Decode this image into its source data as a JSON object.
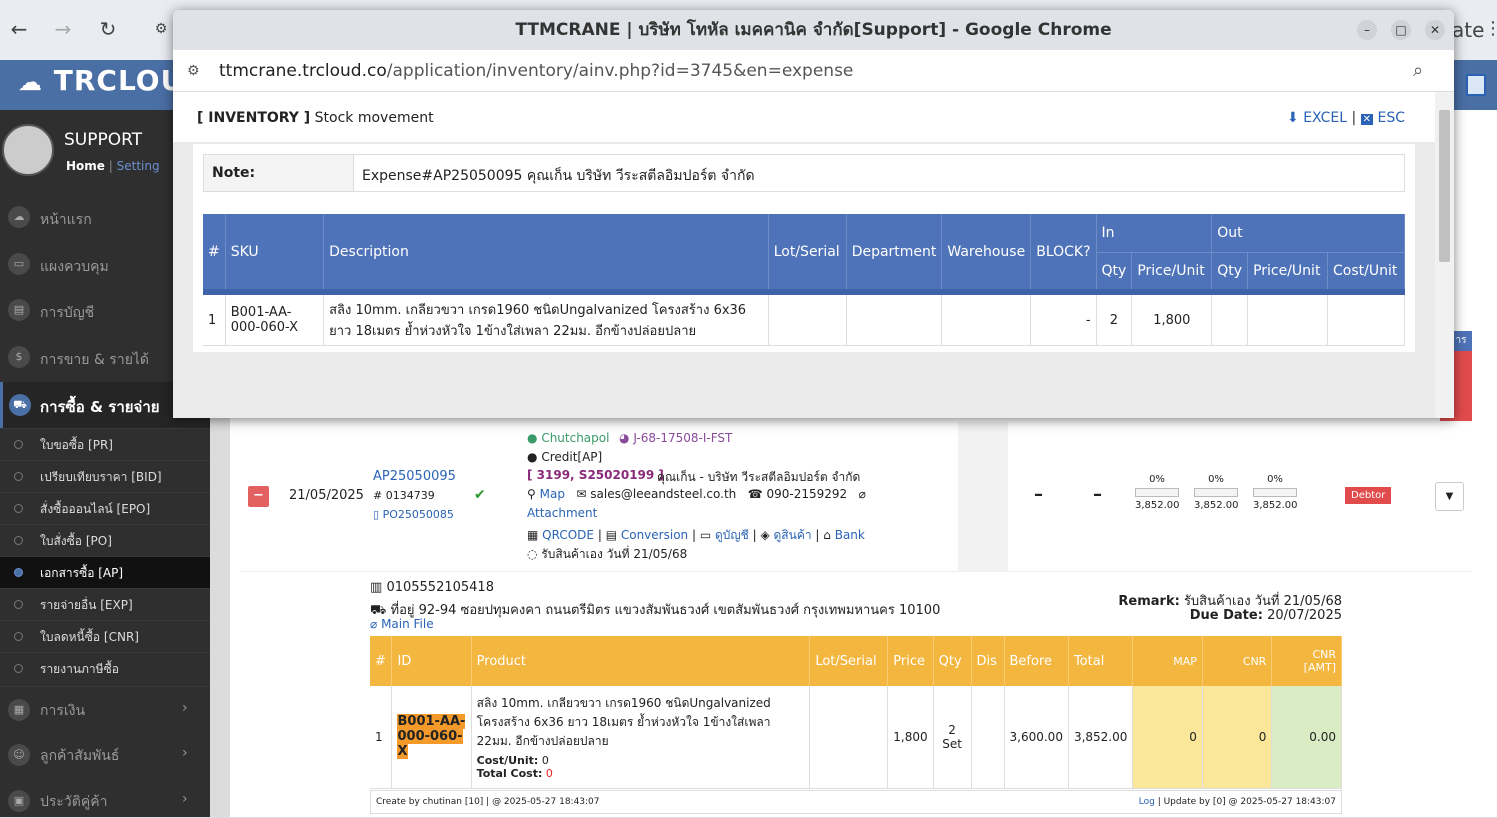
{
  "browser": {
    "partial_title": "ate"
  },
  "app": {
    "logo_text": "TRCLOUD",
    "user_name": "SUPPORT",
    "home": "Home",
    "sep": "|",
    "setting": "Setting"
  },
  "sidebar": {
    "items": [
      {
        "label": "หน้าแรก",
        "icon": "cloud-icon"
      },
      {
        "label": "แผงควบคุม",
        "icon": "monitor-icon"
      },
      {
        "label": "การบัญชี",
        "icon": "book-icon"
      },
      {
        "label": "การขาย & รายได้",
        "icon": "dollar-icon"
      },
      {
        "label": "การซื้อ & รายจ่าย",
        "icon": "cart-icon"
      }
    ],
    "sub_items": [
      "ใบขอซื้อ [PR]",
      "เปรียบเทียบราคา [BID]",
      "สั่งซื้อออนไลน์ [EPO]",
      "ใบสั่งซื้อ [PO]",
      "เอกสารซื้อ [AP]",
      "รายจ่ายอื่น [EXP]",
      "ใบลดหนี้ซื้อ [CNR]",
      "รายงานภาษีซื้อ"
    ],
    "bottom_items": [
      {
        "label": "การเงิน"
      },
      {
        "label": "ลูกค้าสัมพันธ์"
      },
      {
        "label": "ประวัติคู่ค้า"
      }
    ]
  },
  "popup": {
    "window_title": "TTMCRANE | บริษัท โทหัล เมคคานิค จำกัด[Support] - Google Chrome",
    "url_host": "ttmcrane.trcloud.co",
    "url_path": "/application/inventory/ainv.php?id=3745&en=expense",
    "header_bracket": "[ INVENTORY ]",
    "header_title": "Stock movement",
    "excel": "EXCEL",
    "esc": "ESC",
    "note_label": "Note:",
    "note_value": "Expense#AP25050095 คุณเก็น บริษัท วีระสตีลอิมปอร์ต จำกัด",
    "columns": {
      "num": "#",
      "sku": "SKU",
      "desc": "Description",
      "lot": "Lot/Serial",
      "dept": "Department",
      "wh": "Warehouse",
      "block": "BLOCK?",
      "in": "In",
      "out": "Out",
      "qty": "Qty",
      "price": "Price/Unit",
      "cost": "Cost/Unit"
    },
    "row": {
      "num": "1",
      "sku": "B001-AA-000-060-X",
      "desc": "สลิง 10mm. เกลียวขวา เกรด1960 ชนิดUngalvanized โครงสร้าง 6x36 ยาว 18เมตร ย้ำห่วงหัวใจ 1ข้างใส่เพลา 22มม. อีกข้างปล่อยปลาย",
      "block": "-",
      "in_qty": "2",
      "in_price": "1,800"
    }
  },
  "record": {
    "date": "21/05/2025",
    "doc_no": "AP25050095",
    "ref_no": "# 0134739",
    "po_no": "PO25050085",
    "staff": "Chutchapol",
    "job": "J-68-17508-I-FST",
    "credit": "Credit[AP]",
    "supplier_code": "[ 3199, S25020199 ]",
    "supplier": "คุณเก็น - บริษัท วีระสตีลอิมปอร์ต จำกัด",
    "map": "Map",
    "email": "sales@leeandsteel.co.th",
    "phone": "090-2159292",
    "attachment": "Attachment",
    "qrcode": "QRCODE",
    "conversion": "Conversion",
    "ledger": "ดูบัญชี",
    "product_link": "ดูสินค้า",
    "bank": "Bank",
    "receive_note": "รับสินค้าเอง วันที่ 21/05/68",
    "dash1": "–",
    "dash2": "–",
    "progress": [
      {
        "pct": "0%",
        "amt": "3,852.00"
      },
      {
        "pct": "0%",
        "amt": "3,852.00"
      },
      {
        "pct": "0%",
        "amt": "3,852.00"
      }
    ],
    "badge": "Debtor",
    "tax_id": "0105552105418",
    "address": "ที่อยู่ 92-94 ซอยปทุมคงคา ถนนตรีมิตร แขวงสัมพันธวงศ์ เขตสัมพันธวงศ์ กรุงเทพมหานคร 10100",
    "main_file": "Main File",
    "remark_label": "Remark:",
    "remark": "รับสินค้าเอง วันที่ 21/05/68",
    "due_label": "Due Date:",
    "due": "20/07/2025",
    "items_cols": {
      "num": "#",
      "id": "ID",
      "product": "Product",
      "lot": "Lot/Serial",
      "price": "Price",
      "qty": "Qty",
      "dis": "Dis",
      "before": "Before",
      "total": "Total",
      "map": "MAP",
      "cnr": "CNR",
      "cnr_amt": "CNR [AMT]"
    },
    "item": {
      "num": "1",
      "id": "B001-AA-000-060-X",
      "product": "สลิง 10mm. เกลียวขวา เกรด1960 ชนิดUngalvanized โครงสร้าง 6x36 ยาว 18เมตร ย้ำห่วงหัวใจ 1ข้างใส่เพลา 22มม. อีกข้างปล่อยปลาย",
      "cost_unit_label": "Cost/Unit:",
      "cost_unit": "0",
      "total_cost_label": "Total Cost:",
      "total_cost": "0",
      "price": "1,800",
      "qty": "2",
      "unit": "Set",
      "before": "3,600.00",
      "total": "3,852.00",
      "map": "0",
      "cnr": "0",
      "cnr_amt": "0.00"
    },
    "created": "Create by chutinan [10] | @ 2025-05-27 18:43:07",
    "log": "Log",
    "updated": "| Update by [0] @ 2025-05-27 18:43:07",
    "right_tag": "าร"
  }
}
